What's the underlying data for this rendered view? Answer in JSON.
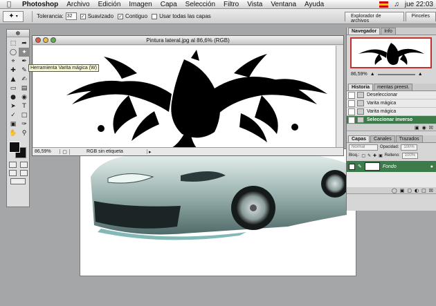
{
  "menubar": {
    "app": "Photoshop",
    "items": [
      "Archivo",
      "Edición",
      "Imagen",
      "Capa",
      "Selección",
      "Filtro",
      "Vista",
      "Ventana",
      "Ayuda"
    ],
    "clock": "jue 22:03"
  },
  "options": {
    "tolerance_label": "Tolerancia:",
    "tolerance_value": "32",
    "antialias_label": "Suavizado",
    "contiguous_label": "Contiguo",
    "all_layers_label": "Usar todas las capas"
  },
  "palette_well": {
    "file_browser": "Explorador de archivos",
    "brushes": "Pinceles"
  },
  "tooltip": "Herramienta Varita mágica (W)",
  "document": {
    "title": "Pintura lateral.jpg al 86,6% (RGB)",
    "zoom": "86,59%",
    "profile": "RGB sin etiqueta"
  },
  "navigator": {
    "tab1": "Navegador",
    "tab2": "Info",
    "zoom": "86,59%"
  },
  "history": {
    "tab1": "Historia",
    "tab2": "mentas preest.",
    "items": [
      "Deseleccionar",
      "Varita mágica",
      "Varita mágica",
      "Seleccionar inverso"
    ]
  },
  "layers": {
    "tab1": "Capas",
    "tab2": "Canales",
    "tab3": "Trazados",
    "blend_mode": "Normal",
    "opacity_label": "Opacidad:",
    "opacity_value": "100%",
    "lock_label": "Bloq.:",
    "fill_label": "Relleno:",
    "fill_value": "100%",
    "layer_name": "Fondo"
  },
  "colors": {
    "accent_green": "#3b7c4a",
    "nav_box": "#c03030"
  }
}
